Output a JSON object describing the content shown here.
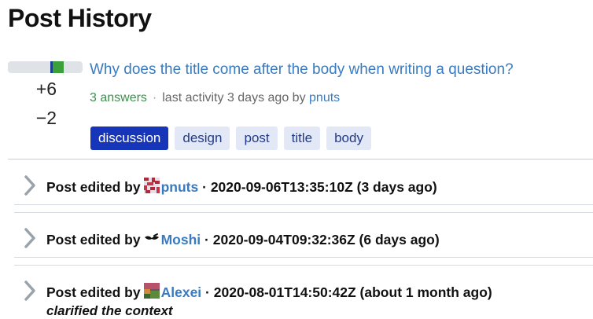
{
  "page": {
    "title": "Post History"
  },
  "post": {
    "title": "Why does the title come after the body when writing a question?",
    "score_up": "+6",
    "score_down": "−2",
    "vote_ratio": 0.75,
    "answers": "3 answers",
    "separator": "·",
    "activity": "last activity 3 days ago by",
    "activity_user": "pnuts",
    "tags": [
      {
        "label": "discussion"
      },
      {
        "label": "design"
      },
      {
        "label": "post"
      },
      {
        "label": "title"
      },
      {
        "label": "body"
      }
    ]
  },
  "history": [
    {
      "action": "Post edited by",
      "user": "pnuts",
      "separator": "·",
      "timestamp": "2020-09-06T13:35:10Z (3 days ago)",
      "avatar": "pixel-avatar-icon",
      "comment": ""
    },
    {
      "action": "Post edited by",
      "user": "Moshi",
      "separator": "·",
      "timestamp": "2020-09-04T09:32:36Z (6 days ago)",
      "avatar": "mustache-avatar-icon",
      "comment": ""
    },
    {
      "action": "Post edited by",
      "user": "Alexei",
      "separator": "·",
      "timestamp": "2020-08-01T14:50:42Z (about 1 month ago)",
      "avatar": "landscape-avatar-icon",
      "comment": "clarified the context"
    }
  ],
  "colors": {
    "link": "#3a7bbf",
    "answers": "#3d8f4e",
    "tag_primary": "#1635b8",
    "tag_bg": "#e3e8f7"
  }
}
